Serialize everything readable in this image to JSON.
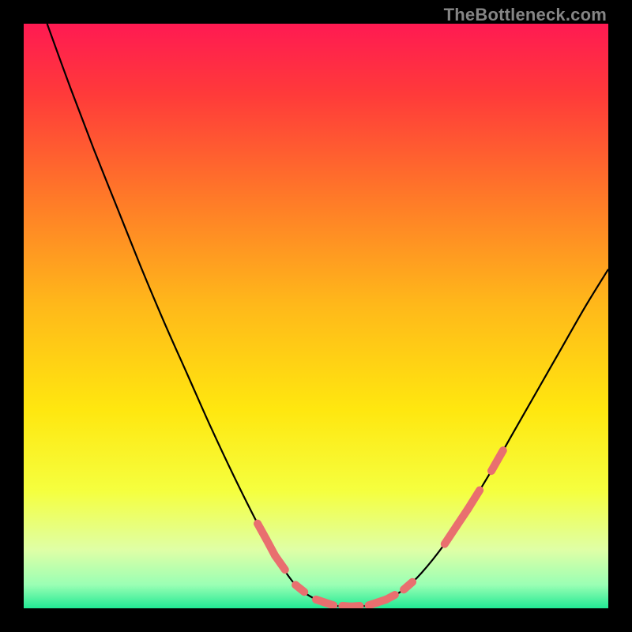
{
  "watermark": "TheBottleneck.com",
  "chart_data": {
    "type": "line",
    "title": "",
    "xlabel": "",
    "ylabel": "",
    "xlim": [
      0,
      100
    ],
    "ylim": [
      0,
      100
    ],
    "legend": null,
    "grid": false,
    "background_gradient": {
      "stops": [
        {
          "offset": 0.0,
          "color": "#ff1a52"
        },
        {
          "offset": 0.12,
          "color": "#ff3a3a"
        },
        {
          "offset": 0.3,
          "color": "#ff7a28"
        },
        {
          "offset": 0.48,
          "color": "#ffb81a"
        },
        {
          "offset": 0.66,
          "color": "#ffe70f"
        },
        {
          "offset": 0.8,
          "color": "#f5ff3f"
        },
        {
          "offset": 0.9,
          "color": "#dfffa6"
        },
        {
          "offset": 0.96,
          "color": "#9affb4"
        },
        {
          "offset": 1.0,
          "color": "#22e994"
        }
      ]
    },
    "series": [
      {
        "name": "bottleneck-curve",
        "color": "#000000",
        "points": [
          {
            "x": 4.0,
            "y": 100.0
          },
          {
            "x": 8.0,
            "y": 89.0
          },
          {
            "x": 12.0,
            "y": 78.5
          },
          {
            "x": 16.0,
            "y": 68.5
          },
          {
            "x": 20.0,
            "y": 58.5
          },
          {
            "x": 24.0,
            "y": 49.0
          },
          {
            "x": 28.0,
            "y": 40.0
          },
          {
            "x": 32.0,
            "y": 31.0
          },
          {
            "x": 36.0,
            "y": 22.5
          },
          {
            "x": 40.0,
            "y": 14.5
          },
          {
            "x": 43.0,
            "y": 9.0
          },
          {
            "x": 46.5,
            "y": 4.0
          },
          {
            "x": 50.0,
            "y": 1.5
          },
          {
            "x": 53.0,
            "y": 0.5
          },
          {
            "x": 56.0,
            "y": 0.3
          },
          {
            "x": 59.0,
            "y": 0.5
          },
          {
            "x": 62.0,
            "y": 1.5
          },
          {
            "x": 65.0,
            "y": 3.2
          },
          {
            "x": 68.0,
            "y": 6.0
          },
          {
            "x": 72.0,
            "y": 11.0
          },
          {
            "x": 76.0,
            "y": 17.0
          },
          {
            "x": 80.0,
            "y": 23.5
          },
          {
            "x": 84.0,
            "y": 30.5
          },
          {
            "x": 88.0,
            "y": 37.5
          },
          {
            "x": 92.0,
            "y": 44.5
          },
          {
            "x": 96.0,
            "y": 51.5
          },
          {
            "x": 100.0,
            "y": 58.0
          }
        ]
      }
    ],
    "markers": {
      "name": "highlight-segments",
      "color": "#e96f6f",
      "stroke_width": 10,
      "segments": [
        [
          {
            "x": 40.0,
            "y": 14.5
          },
          {
            "x": 41.5,
            "y": 11.8
          }
        ],
        [
          {
            "x": 41.5,
            "y": 11.8
          },
          {
            "x": 43.0,
            "y": 9.0
          }
        ],
        [
          {
            "x": 43.0,
            "y": 9.0
          },
          {
            "x": 44.7,
            "y": 6.6
          }
        ],
        [
          {
            "x": 46.5,
            "y": 4.0
          },
          {
            "x": 48.0,
            "y": 2.8
          }
        ],
        [
          {
            "x": 50.0,
            "y": 1.5
          },
          {
            "x": 51.5,
            "y": 1.0
          }
        ],
        [
          {
            "x": 51.5,
            "y": 1.0
          },
          {
            "x": 53.0,
            "y": 0.5
          }
        ],
        [
          {
            "x": 54.5,
            "y": 0.4
          },
          {
            "x": 56.0,
            "y": 0.3
          }
        ],
        [
          {
            "x": 56.0,
            "y": 0.3
          },
          {
            "x": 57.5,
            "y": 0.4
          }
        ],
        [
          {
            "x": 59.0,
            "y": 0.5
          },
          {
            "x": 60.5,
            "y": 1.0
          }
        ],
        [
          {
            "x": 60.5,
            "y": 1.0
          },
          {
            "x": 62.0,
            "y": 1.5
          }
        ],
        [
          {
            "x": 62.0,
            "y": 1.5
          },
          {
            "x": 63.5,
            "y": 2.3
          }
        ],
        [
          {
            "x": 65.0,
            "y": 3.2
          },
          {
            "x": 66.5,
            "y": 4.5
          }
        ],
        [
          {
            "x": 72.0,
            "y": 11.0
          },
          {
            "x": 74.0,
            "y": 14.0
          }
        ],
        [
          {
            "x": 74.0,
            "y": 14.0
          },
          {
            "x": 76.0,
            "y": 17.0
          }
        ],
        [
          {
            "x": 76.0,
            "y": 17.0
          },
          {
            "x": 78.0,
            "y": 20.2
          }
        ],
        [
          {
            "x": 80.0,
            "y": 23.5
          },
          {
            "x": 82.0,
            "y": 27.0
          }
        ]
      ]
    }
  }
}
